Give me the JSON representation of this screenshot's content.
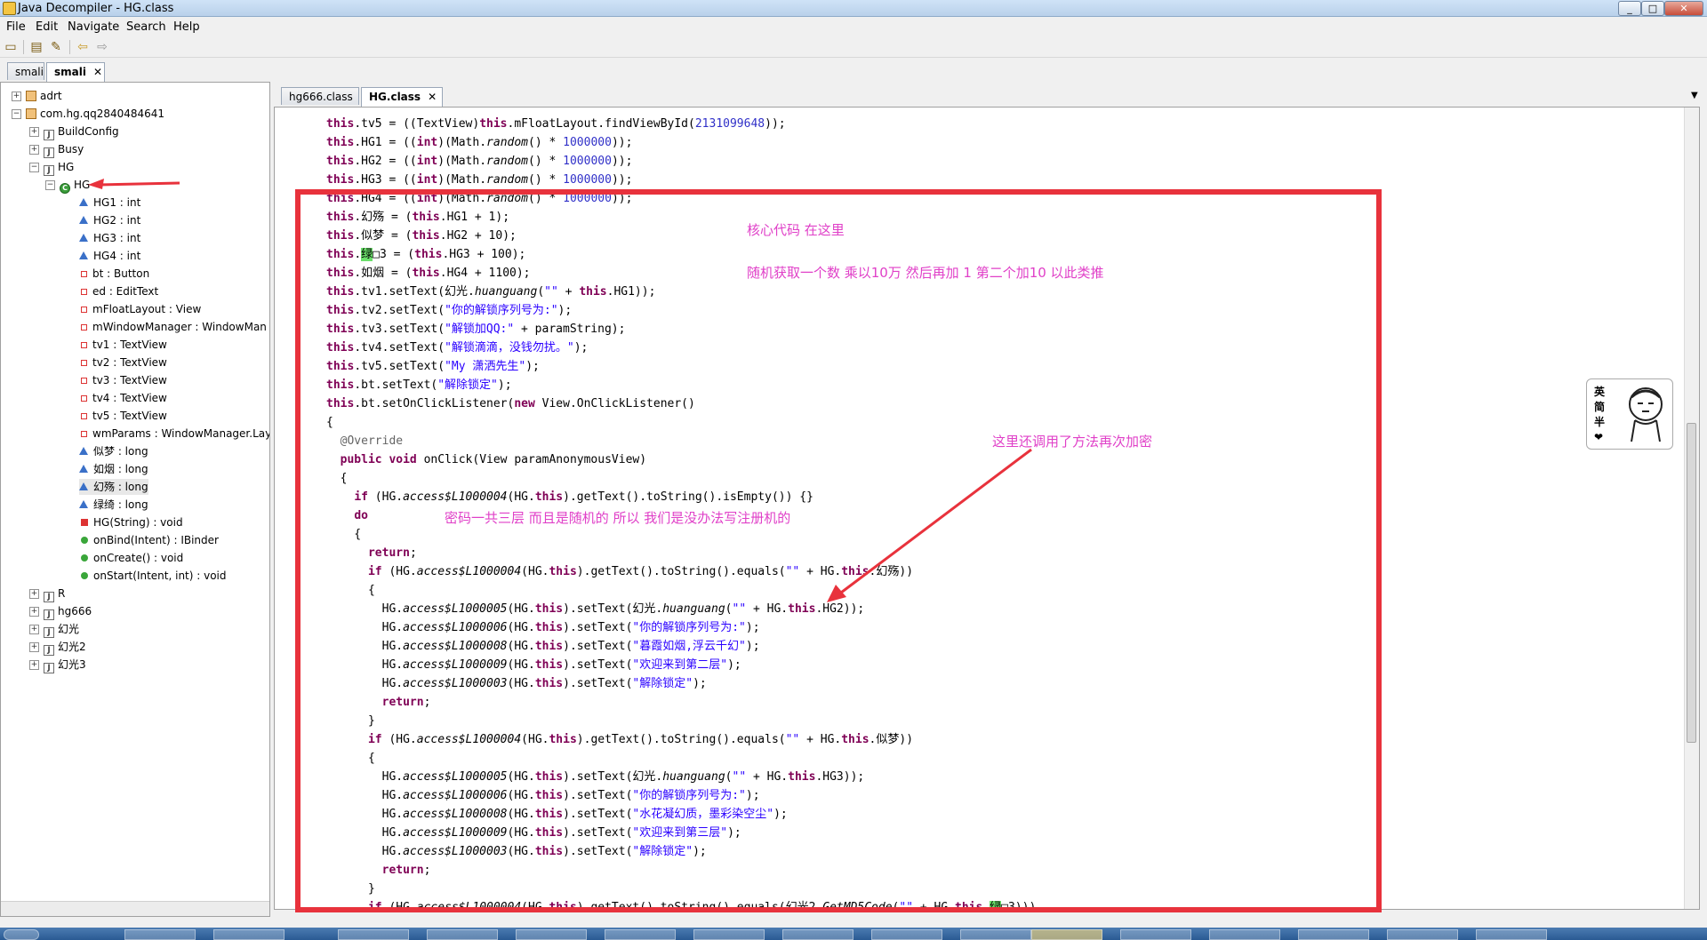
{
  "window": {
    "title": "Java Decompiler - HG.class",
    "min": "_",
    "max": "□",
    "close": "✕"
  },
  "menu": [
    "File",
    "Edit",
    "Navigate",
    "Search",
    "Help"
  ],
  "toolbar": {
    "open": "open-folder-icon",
    "open_type": "open-type-icon",
    "find": "find-icon",
    "back": "back-icon",
    "forward": "forward-icon"
  },
  "left_tabs": [
    {
      "label": "smali"
    },
    {
      "label": "smali",
      "close": "✕"
    }
  ],
  "tree": {
    "nodes": [
      {
        "label": "adrt",
        "expander": "+"
      },
      {
        "label": "com.hg.qq2840484641",
        "expander": "−"
      },
      {
        "label": "BuildConfig",
        "expander": "+"
      },
      {
        "label": "Busy",
        "expander": "+"
      },
      {
        "label": "HG",
        "expander": "−"
      },
      {
        "label": "HG",
        "expander": "−"
      },
      {
        "label": "HG1 : int"
      },
      {
        "label": "HG2 : int"
      },
      {
        "label": "HG3 : int"
      },
      {
        "label": "HG4 : int"
      },
      {
        "label": "bt : Button"
      },
      {
        "label": "ed : EditText"
      },
      {
        "label": "mFloatLayout : View"
      },
      {
        "label": "mWindowManager : WindowMan"
      },
      {
        "label": "tv1 : TextView"
      },
      {
        "label": "tv2 : TextView"
      },
      {
        "label": "tv3 : TextView"
      },
      {
        "label": "tv4 : TextView"
      },
      {
        "label": "tv5 : TextView"
      },
      {
        "label": "wmParams : WindowManager.Lay"
      },
      {
        "label": "似梦 : long"
      },
      {
        "label": "如烟 : long"
      },
      {
        "label": "幻殇 : long"
      },
      {
        "label": "绿绮 : long"
      },
      {
        "label": "HG(String) : void"
      },
      {
        "label": "onBind(Intent) : IBinder"
      },
      {
        "label": "onCreate() : void"
      },
      {
        "label": "onStart(Intent, int) : void"
      },
      {
        "label": "R",
        "expander": "+"
      },
      {
        "label": "hg666",
        "expander": "+"
      },
      {
        "label": "幻光",
        "expander": "+"
      },
      {
        "label": "幻光2",
        "expander": "+"
      },
      {
        "label": "幻光3",
        "expander": "+"
      }
    ]
  },
  "editor_tabs": [
    {
      "label": "hg666.class"
    },
    {
      "label": "HG.class",
      "close": "✕"
    }
  ],
  "code_lines": [
    "this.tv5 = ((TextView)this.mFloatLayout.findViewById(2131099648));",
    "this.HG1 = ((int)(Math.random() * 1000000));",
    "this.HG2 = ((int)(Math.random() * 1000000));",
    "this.HG3 = ((int)(Math.random() * 1000000));",
    "this.HG4 = ((int)(Math.random() * 1000000));",
    "this.幻殇 = (this.HG1 + 1);",
    "this.似梦 = (this.HG2 + 10);",
    "this.绿□3 = (this.HG3 + 100);",
    "this.如烟 = (this.HG4 + 1100);",
    "this.tv1.setText(幻光.huanguang(\"\" + this.HG1));",
    "this.tv2.setText(\"你的解锁序列号为:\");",
    "this.tv3.setText(\"解锁加QQ:\" + paramString);",
    "this.tv4.setText(\"解锁滴滴，没钱勿扰。\");",
    "this.tv5.setText(\"My 潇洒先生\");",
    "this.bt.setText(\"解除锁定\");",
    "this.bt.setOnClickListener(new View.OnClickListener()",
    "{",
    "  @Override",
    "  public void onClick(View paramAnonymousView)",
    "  {",
    "    if (HG.access$L1000004(HG.this).getText().toString().isEmpty()) {}",
    "    do",
    "    {",
    "      return;",
    "      if (HG.access$L1000004(HG.this).getText().toString().equals(\"\" + HG.this.幻殇))",
    "      {",
    "        HG.access$L1000005(HG.this).setText(幻光.huanguang(\"\" + HG.this.HG2));",
    "        HG.access$L1000006(HG.this).setText(\"你的解锁序列号为:\");",
    "        HG.access$L1000008(HG.this).setText(\"暮霞如烟,浮云千幻\");",
    "        HG.access$L1000009(HG.this).setText(\"欢迎来到第二层\");",
    "        HG.access$L1000003(HG.this).setText(\"解除锁定\");",
    "        return;",
    "      }",
    "      if (HG.access$L1000004(HG.this).getText().toString().equals(\"\" + HG.this.似梦))",
    "      {",
    "        HG.access$L1000005(HG.this).setText(幻光.huanguang(\"\" + HG.this.HG3));",
    "        HG.access$L1000006(HG.this).setText(\"你的解锁序列号为:\");",
    "        HG.access$L1000008(HG.this).setText(\"水花凝幻质，墨彩染空尘\");",
    "        HG.access$L1000009(HG.this).setText(\"欢迎来到第三层\");",
    "        HG.access$L1000003(HG.this).setText(\"解除锁定\");",
    "        return;",
    "      }",
    "      if (HG.access$L1000004(HG.this).getText().toString().equals(幻光2.GetMD5Code(\"\" + HG.this.绿□3)))"
  ],
  "notes": {
    "core": "核心代码 在这里",
    "random": "随机获取一个数 乘以10万 然后再加 1 第二个加10 以此类推",
    "encrypt": "这里还调用了方法再次加密",
    "password": "密码一共三层 而且是随机的  所以  我们是没办法写注册机的"
  },
  "ime": {
    "labels": [
      "英",
      "简",
      "半",
      "❤"
    ]
  },
  "colors": {
    "annotation": "#e040c8",
    "box": "#e8323c",
    "keyword": "#7f0055",
    "string": "#2a00ff",
    "number": "#3030c8"
  }
}
